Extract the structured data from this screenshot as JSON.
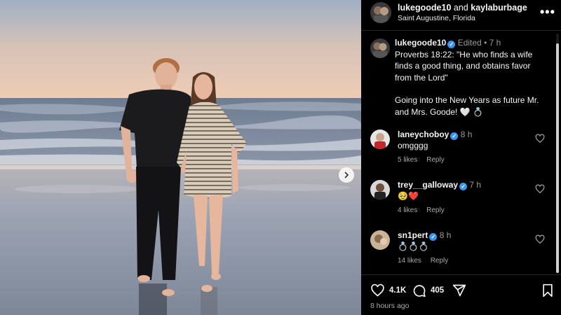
{
  "header": {
    "user1": "lukegoode10",
    "joiner": "and",
    "user2": "kaylaburbage",
    "location": "Saint Augustine, Florida"
  },
  "post": {
    "username": "lukegoode10",
    "edited": "Edited",
    "dot": "•",
    "age": "7 h",
    "caption_line1": "Proverbs 18:22: \"He who finds a wife finds a good thing, and obtains favor from the Lord\"",
    "caption_line2": "Going into the New Years as future Mr. and Mrs. Goode! 🤍 💍"
  },
  "comments": [
    {
      "username": "laneychoboy",
      "age": "8 h",
      "text": "omgggg",
      "likes": "5 likes",
      "reply": "Reply"
    },
    {
      "username": "trey__galloway",
      "age": "7 h",
      "text": "🥹❤️",
      "likes": "4 likes",
      "reply": "Reply"
    },
    {
      "username": "sn1pert",
      "age": "8 h",
      "text": "💍💍💍",
      "likes": "14 likes",
      "reply": "Reply"
    }
  ],
  "actions": {
    "likes_count": "4.1K",
    "comments_count": "405",
    "posted": "8 hours ago"
  },
  "colors": {
    "verified": "#3797f0",
    "panel_bg": "#000000"
  },
  "icons": [
    "more-icon",
    "verified-icon",
    "heart-icon",
    "comment-icon",
    "share-icon",
    "bookmark-icon",
    "chevron-right-icon"
  ]
}
